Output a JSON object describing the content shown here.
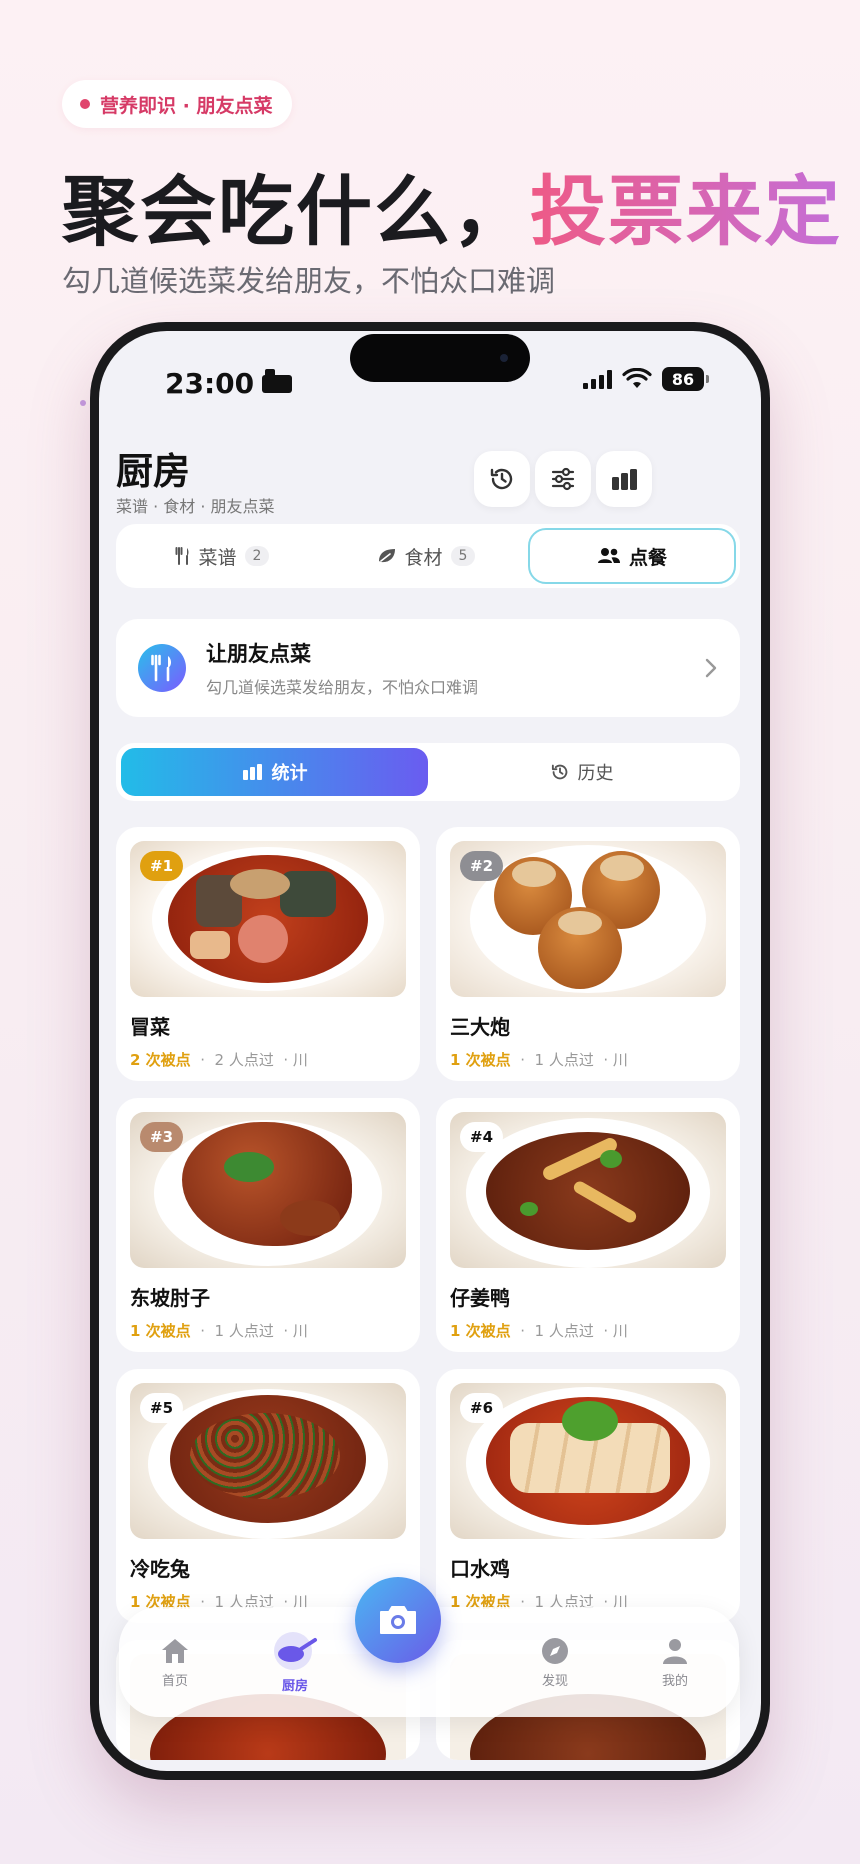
{
  "promo": {
    "badge": "营养即识 · 朋友点菜",
    "headline_a": "聚会吃什么，",
    "headline_b": "投票来定",
    "subhead": "勾几道候选菜发给朋友，不怕众口难调"
  },
  "status_bar": {
    "time": "23:00",
    "battery": "86"
  },
  "header": {
    "title": "厨房",
    "subtitle": "菜谱 · 食材 · 朋友点菜"
  },
  "tabs": [
    {
      "label": "菜谱",
      "count": "2"
    },
    {
      "label": "食材",
      "count": "5"
    },
    {
      "label": "点餐"
    }
  ],
  "invite": {
    "title": "让朋友点菜",
    "desc": "勾几道候选菜发给朋友，不怕众口难调"
  },
  "subtabs": {
    "stats": "统计",
    "history": "历史"
  },
  "dishes": [
    {
      "rank": "#1",
      "name": "冒菜",
      "votes": "2 次被点",
      "people": "2 人点过",
      "cuisine": "川"
    },
    {
      "rank": "#2",
      "name": "三大炮",
      "votes": "1 次被点",
      "people": "1 人点过",
      "cuisine": "川"
    },
    {
      "rank": "#3",
      "name": "东坡肘子",
      "votes": "1 次被点",
      "people": "1 人点过",
      "cuisine": "川"
    },
    {
      "rank": "#4",
      "name": "仔姜鸭",
      "votes": "1 次被点",
      "people": "1 人点过",
      "cuisine": "川"
    },
    {
      "rank": "#5",
      "name": "冷吃兔",
      "votes": "1 次被点",
      "people": "1 人点过",
      "cuisine": "川"
    },
    {
      "rank": "#6",
      "name": "口水鸡",
      "votes": "1 次被点",
      "people": "1 人点过",
      "cuisine": "川"
    }
  ],
  "tabbar": {
    "home": "首页",
    "kitchen": "厨房",
    "discover": "发现",
    "me": "我的"
  },
  "colors": {
    "accent_pink": "#ee5a86",
    "accent_purple": "#6a5ce8",
    "vote_highlight": "#e0a010",
    "rank1": "#e0a010"
  }
}
